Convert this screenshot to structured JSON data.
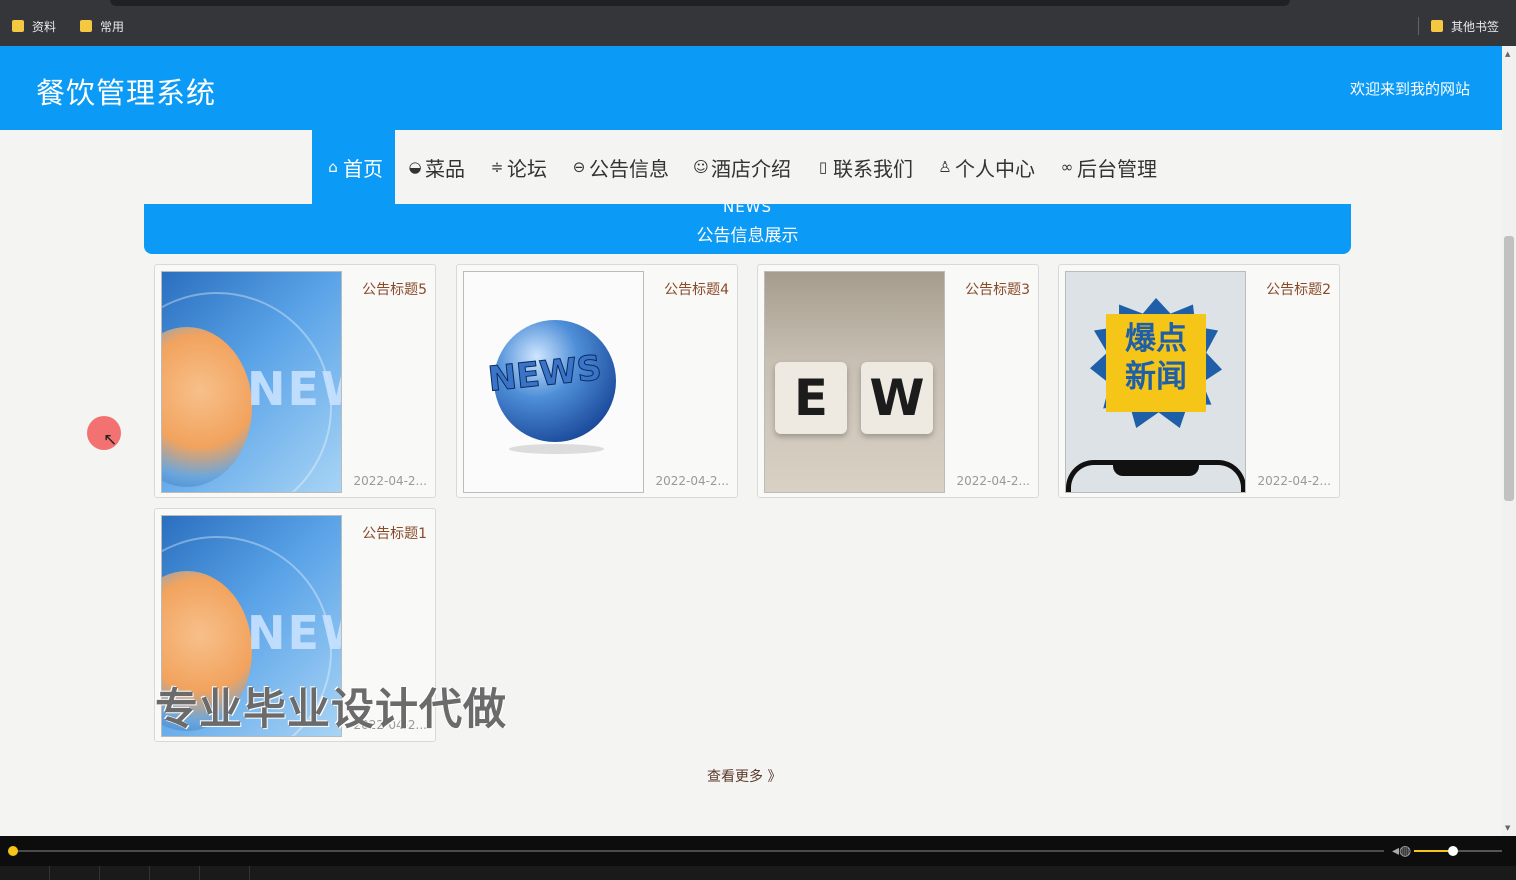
{
  "bookmarks": {
    "items": [
      {
        "label": "资料",
        "icon": "folder-icon"
      },
      {
        "label": "常用",
        "icon": "folder-icon"
      }
    ],
    "other": {
      "label": "其他书签",
      "icon": "folder-icon"
    }
  },
  "header": {
    "title": "餐饮管理系统",
    "welcome": "欢迎来到我的网站"
  },
  "nav": {
    "items": [
      {
        "label": "首页",
        "icon": "home-icon",
        "active": true
      },
      {
        "label": "菜品",
        "icon": "bowl-icon"
      },
      {
        "label": "论坛",
        "icon": "sliders-icon"
      },
      {
        "label": "公告信息",
        "icon": "notice-icon"
      },
      {
        "label": "酒店介绍",
        "icon": "hotel-icon"
      },
      {
        "label": "联系我们",
        "icon": "contact-icon"
      },
      {
        "label": "个人中心",
        "icon": "user-icon"
      },
      {
        "label": "后台管理",
        "icon": "link-icon"
      }
    ]
  },
  "news": {
    "en": "NEWS",
    "cn": "公告信息展示",
    "cards": [
      {
        "title": "公告标题5",
        "date": "2022-04-2..."
      },
      {
        "title": "公告标题4",
        "date": "2022-04-2..."
      },
      {
        "title": "公告标题3",
        "date": "2022-04-2..."
      },
      {
        "title": "公告标题2",
        "date": "2022-04-2..."
      },
      {
        "title": "公告标题1",
        "date": "2022-04-2..."
      }
    ],
    "images": {
      "blue_text": "NEW",
      "globe_text": "NEWS",
      "block_1": "E",
      "block_2": "W",
      "burst_line_1": "爆点",
      "burst_line_2": "新闻"
    },
    "more": "查看更多 》"
  },
  "overlay": {
    "watermark": "专业毕业设计代做"
  },
  "colors": {
    "primary": "#0b9af5",
    "title_text": "#8a4a2a",
    "accent_yellow": "#f5c518"
  }
}
